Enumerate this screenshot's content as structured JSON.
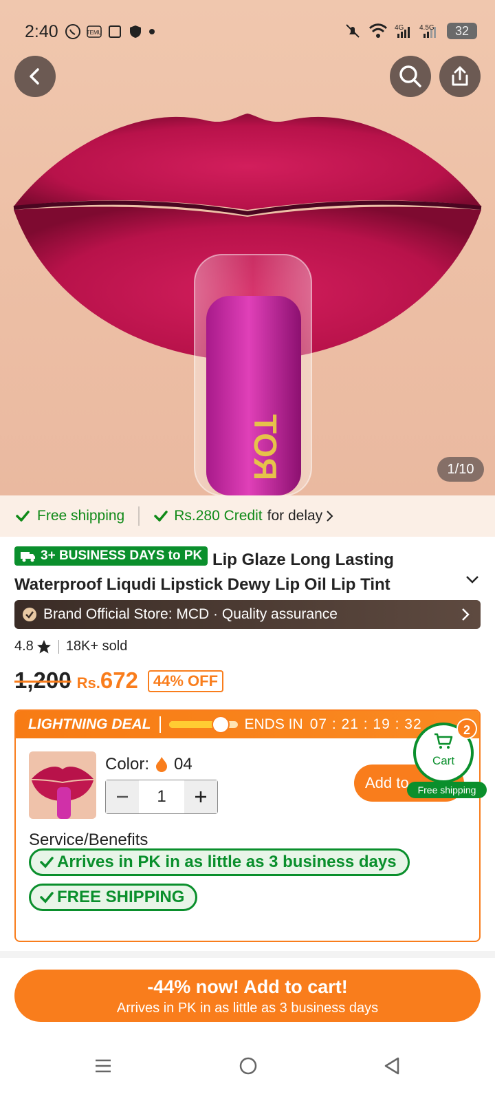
{
  "status_bar": {
    "time": "2:40",
    "battery": "32",
    "icons": [
      "whatsapp-icon",
      "temu-icon",
      "square-icon",
      "shield-icon",
      "dot-icon",
      "mute-icon",
      "wifi-icon",
      "signal-4g-icon",
      "signal-4.5g-icon",
      "battery-icon"
    ]
  },
  "hero": {
    "image_counter": "1/10",
    "back_icon": "back-arrow-icon",
    "search_icon": "search-icon",
    "share_icon": "share-icon"
  },
  "shipping_strip": {
    "free_shipping": "Free shipping",
    "credit_amount": "Rs.280 Credit",
    "credit_suffix": "for delay"
  },
  "product": {
    "delivery_badge": "3+ BUSINESS DAYS to PK",
    "title": "Lip Glaze Long Lasting Waterproof Liqudi Lipstick Dewy Lip Oil Lip Tint"
  },
  "brand_bar": {
    "text": "Brand Official Store: MCD · Quality assurance"
  },
  "rating": {
    "score": "4.8",
    "sold": "18K+ sold"
  },
  "price": {
    "original": "1,200",
    "currency": "Rs.",
    "current": "672",
    "discount": "44% OFF"
  },
  "deal": {
    "title": "LIGHTNING DEAL",
    "ends_label": "ENDS IN",
    "timer": "07 : 21 : 19 : 32",
    "progress": 0.75
  },
  "variant": {
    "color_label": "Color:",
    "color_value": "04",
    "quantity": "1",
    "add_to_label": "Add to"
  },
  "cart": {
    "label": "Cart",
    "count": "2",
    "free_shipping": "Free shipping"
  },
  "service": {
    "title": "Service/Benefits",
    "benefits": [
      "Arrives in PK in as little as 3 business days",
      "FREE SHIPPING"
    ]
  },
  "cta": {
    "line1": "-44% now! Add to cart!",
    "line2": "Arrives in PK in as little as 3 business days"
  },
  "colors": {
    "accent": "#f97d1c",
    "green": "#0a8f2c",
    "lip": "#c0174f"
  }
}
